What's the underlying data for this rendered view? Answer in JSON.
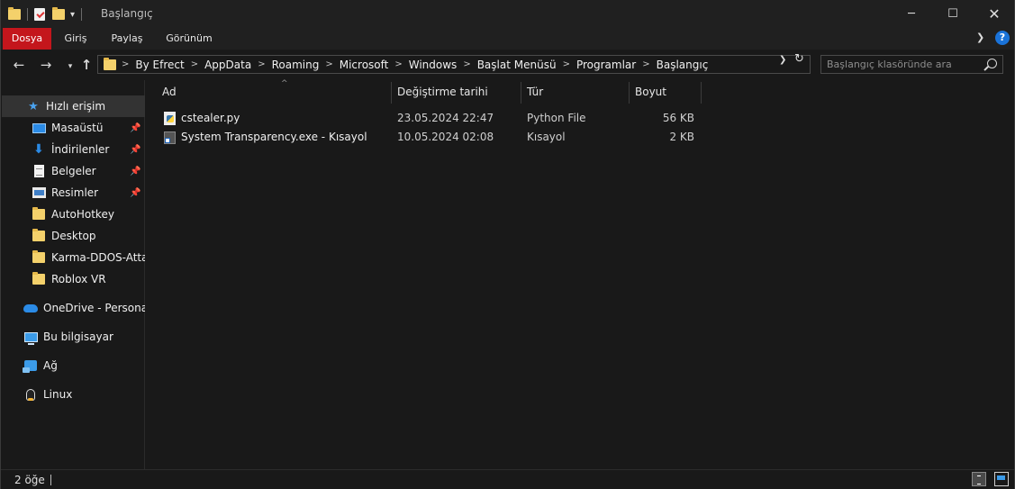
{
  "window": {
    "title": "Başlangıç",
    "controls": {
      "minimize": "─",
      "maximize": "☐",
      "close": "✕"
    }
  },
  "ribbon": {
    "tabs": [
      "Dosya",
      "Giriş",
      "Paylaş",
      "Görünüm"
    ],
    "accent": "#c4161c",
    "help": "?"
  },
  "address": {
    "breadcrumbs": [
      "By Efrect",
      "AppData",
      "Roaming",
      "Microsoft",
      "Windows",
      "Başlat Menüsü",
      "Programlar",
      "Başlangıç"
    ]
  },
  "search": {
    "placeholder": "Başlangıç klasöründe ara"
  },
  "sidebar": {
    "items": [
      {
        "label": "Hızlı erişim",
        "icon": "star-icon"
      },
      {
        "label": "Masaüstü",
        "icon": "desktop-icon",
        "pinned": true
      },
      {
        "label": "İndirilenler",
        "icon": "download-icon",
        "pinned": true
      },
      {
        "label": "Belgeler",
        "icon": "documents-icon",
        "pinned": true
      },
      {
        "label": "Resimler",
        "icon": "pictures-icon",
        "pinned": true
      },
      {
        "label": "AutoHotkey",
        "icon": "folder-icon"
      },
      {
        "label": "Desktop",
        "icon": "folder-icon"
      },
      {
        "label": "Karma-DDOS-Attac",
        "icon": "folder-icon"
      },
      {
        "label": "Roblox VR",
        "icon": "folder-icon"
      },
      {
        "label": "OneDrive - Personal",
        "icon": "onedrive-icon"
      },
      {
        "label": "Bu bilgisayar",
        "icon": "computer-icon"
      },
      {
        "label": "Ağ",
        "icon": "network-icon"
      },
      {
        "label": "Linux",
        "icon": "linux-icon"
      }
    ]
  },
  "filelist": {
    "columns": [
      "Ad",
      "Değiştirme tarihi",
      "Tür",
      "Boyut"
    ],
    "rows": [
      {
        "name": "cstealer.py",
        "date": "23.05.2024 22:47",
        "type": "Python File",
        "size": "56 KB",
        "icon": "python-file-icon"
      },
      {
        "name": "System Transparency.exe - Kısayol",
        "date": "10.05.2024 02:08",
        "type": "Kısayol",
        "size": "2 KB",
        "icon": "shortcut-icon"
      }
    ]
  },
  "status": {
    "item_count": "2 öğe"
  }
}
